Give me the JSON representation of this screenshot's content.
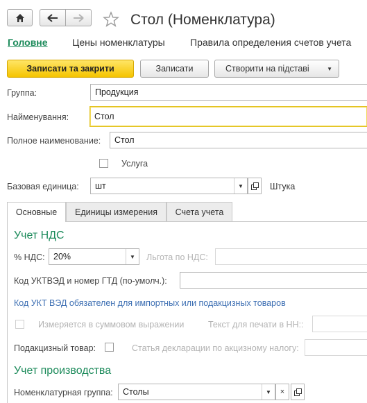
{
  "window": {
    "title": "Стол (Номенклатура)"
  },
  "nav_tabs": [
    {
      "label": "Головне",
      "active": true
    },
    {
      "label": "Цены номенклатуры",
      "active": false
    },
    {
      "label": "Правила определения счетов учета",
      "active": false
    }
  ],
  "toolbar": {
    "save_close_label": "Записати та закрити",
    "save_label": "Записати",
    "create_based_label": "Створити на підставі"
  },
  "form": {
    "group_label": "Группа:",
    "group_value": "Продукция",
    "name_label": "Найменування:",
    "name_value": "Стол",
    "full_name_label": "Полное наименование:",
    "full_name_value": "Стол",
    "service_label": "Услуга",
    "service_checked": false,
    "base_unit_label": "Базовая единица:",
    "base_unit_value": "шт",
    "base_unit_desc": "Штука"
  },
  "sub_tabs": [
    {
      "label": "Основные",
      "active": true
    },
    {
      "label": "Единицы измерения",
      "active": false
    },
    {
      "label": "Счета учета",
      "active": false
    }
  ],
  "vat": {
    "section_title": "Учет НДС",
    "rate_label": "% НДС:",
    "rate_value": "20%",
    "benefit_label": "Льгота по НДС:",
    "benefit_value": "",
    "code_label": "Код УКТВЭД и номер ГТД (по-умолч.):",
    "code_value": "",
    "code_hint": "Код УКТ ВЭД обязателен для импортных или подакцизных товаров",
    "sum_measured_label": "Измеряется в суммовом выражении",
    "print_text_label": "Текст для печати в НН::",
    "excise_label": "Подакцизный товар:",
    "excise_checked": false,
    "declaration_label": "Статья декларации по акцизному налогу:"
  },
  "production": {
    "section_title": "Учет производства",
    "nomenclature_group_label": "Номенклатурная группа:",
    "nomenclature_group_value": "Столы"
  },
  "colors": {
    "accent_green": "#1b8a5a",
    "primary_button": "#f5c400",
    "hint_blue": "#3d6fb3"
  }
}
